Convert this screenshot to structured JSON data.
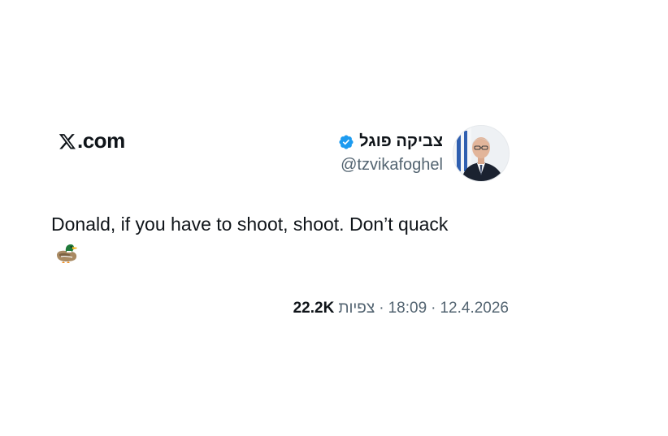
{
  "brand": {
    "label": ".com",
    "icon": "x-logo-icon"
  },
  "author": {
    "display_name": "צביקה פוגל",
    "handle": "@tzvikafoghel",
    "verified": true,
    "verified_color": "#1d9bf0",
    "avatar_icon": "profile-photo"
  },
  "tweet": {
    "text": "Donald, if you have to shoot, shoot. Don’t quack",
    "emoji_icon": "duck-icon"
  },
  "meta": {
    "date": "12.4.2026",
    "time": "18:09",
    "views_label": "צפיות",
    "views_count": "22.2K",
    "separator": "·"
  }
}
